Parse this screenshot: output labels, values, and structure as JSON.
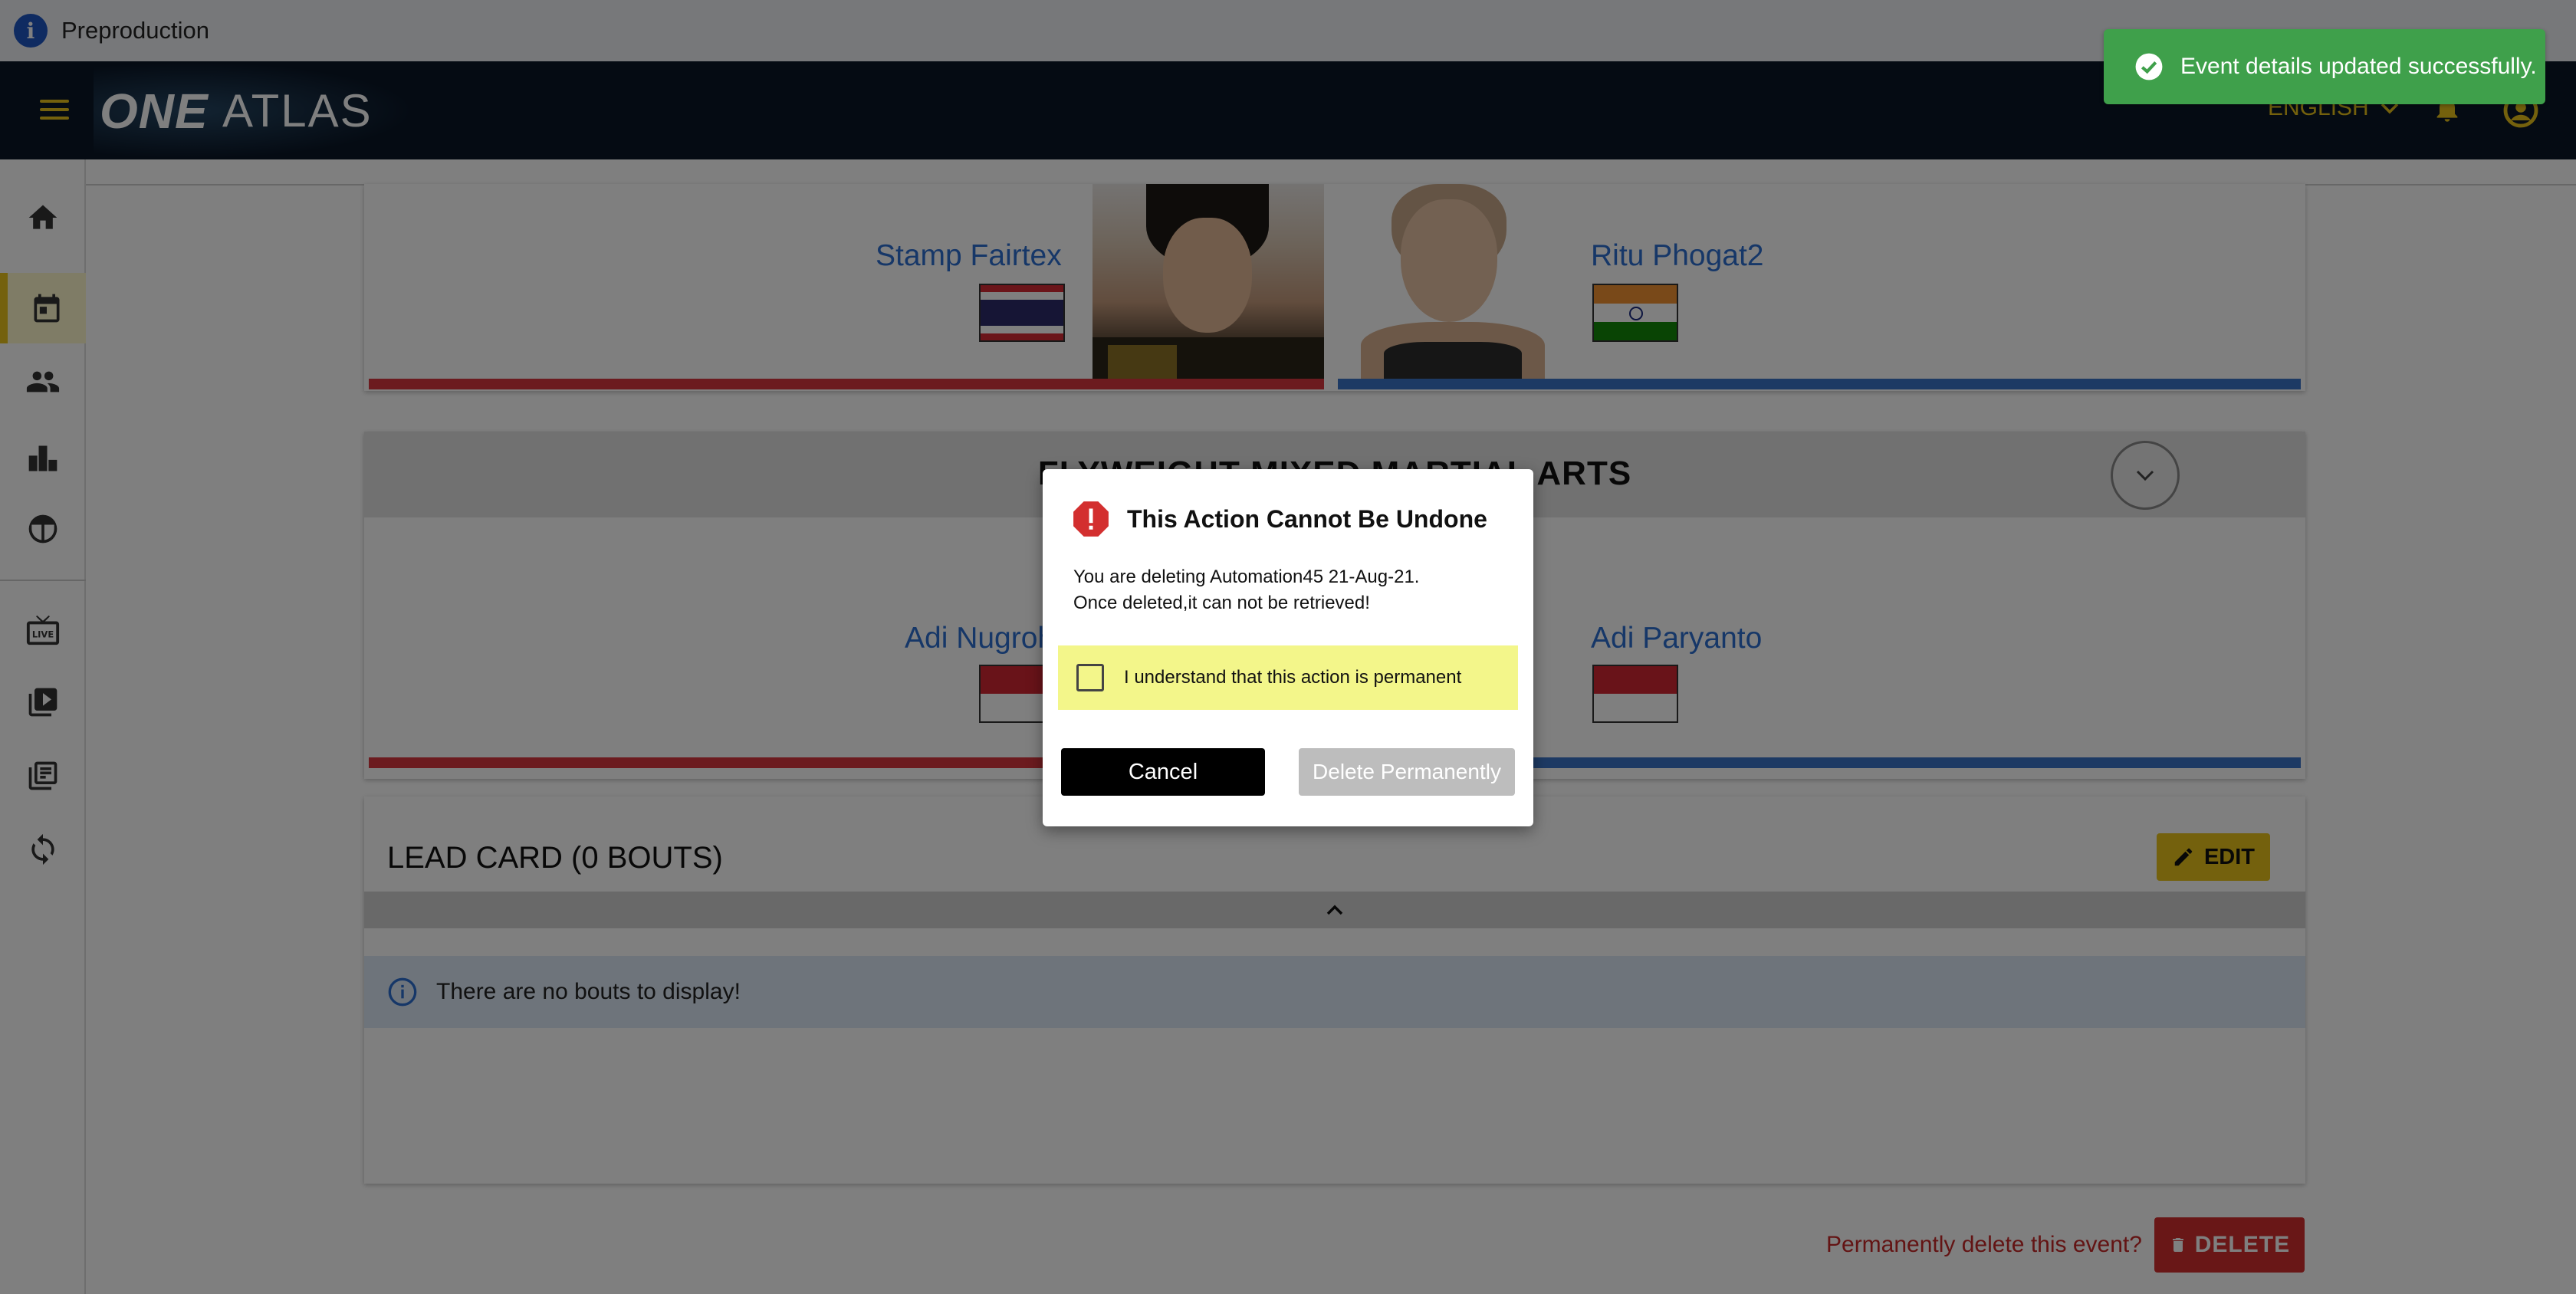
{
  "env": {
    "label": "Preproduction"
  },
  "header": {
    "logo_one": "ONE",
    "logo_atlas": "ATLAS",
    "language": "ENGLISH"
  },
  "sidebar": {
    "items": [
      {
        "icon": "home-icon"
      },
      {
        "icon": "calendar-icon",
        "active": true
      },
      {
        "icon": "people-icon"
      },
      {
        "icon": "leaderboard-icon"
      },
      {
        "icon": "shield-icon"
      },
      {
        "icon": "live-tv-icon"
      },
      {
        "icon": "video-library-icon"
      },
      {
        "icon": "collections-icon"
      },
      {
        "icon": "sync-icon"
      }
    ]
  },
  "bouts": [
    {
      "red_name": "Stamp Fairtex",
      "blue_name": "Ritu Phogat2"
    },
    {
      "weight_class": "FLYWEIGHT MIXED MARTIAL ARTS",
      "red_name": "Adi Nugroho",
      "blue_name": "Adi Paryanto"
    }
  ],
  "lead_card": {
    "title": "LEAD CARD (0 BOUTS)",
    "edit_label": "EDIT",
    "empty_message": "There are no bouts to display!"
  },
  "delete_section": {
    "question": "Permanently delete this event?",
    "button_label": "DELETE"
  },
  "toast": {
    "message": "Event details updated successfully."
  },
  "dialog": {
    "title": "This Action Cannot Be Undone",
    "line1": "You are deleting Automation45 21-Aug-21.",
    "line2": "Once deleted,it can not be retrieved!",
    "checkbox_label": "I understand that this action is permanent",
    "cancel_label": "Cancel",
    "delete_label": "Delete Permanently"
  },
  "colors": {
    "accent": "#e8c21a",
    "header_bg": "#0a1626",
    "red_corner": "#d9363e",
    "blue_corner": "#3b74c9",
    "success": "#3fa04b",
    "danger": "#d32f2f"
  }
}
